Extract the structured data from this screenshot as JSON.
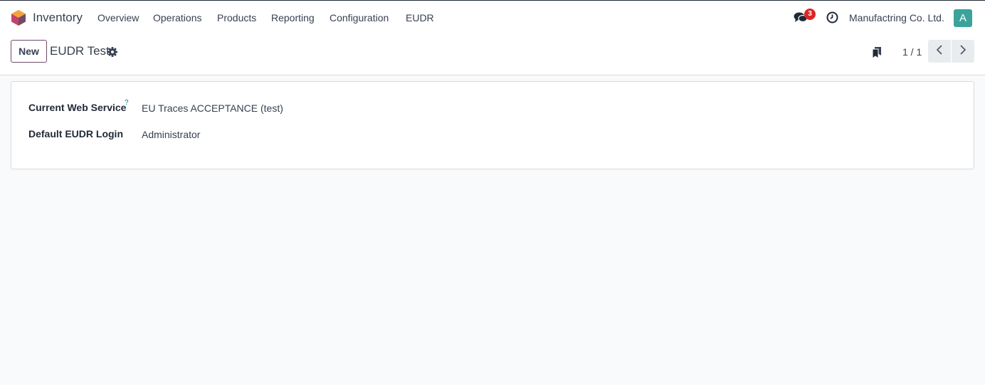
{
  "navbar": {
    "app_name": "Inventory",
    "menu": [
      "Overview",
      "Operations",
      "Products",
      "Reporting",
      "Configuration",
      "EUDR"
    ],
    "messages_count": "3",
    "company": "Manufactring Co. Ltd.",
    "avatar_letter": "A",
    "icons": {
      "logo": "app-logo-icon",
      "chat": "chat-icon",
      "activity": "clock-icon"
    }
  },
  "control_panel": {
    "new_label": "New",
    "record_title": "EUDR Test",
    "pager_value": "1 / 1",
    "icons": {
      "settings": "gear-icon",
      "bookmark": "bookmark-icon",
      "prev": "chevron-left-icon",
      "next": "chevron-right-icon"
    }
  },
  "form": {
    "fields": [
      {
        "label": "Current Web Service",
        "help": "?",
        "value": "EU Traces ACCEPTANCE (test)"
      },
      {
        "label": "Default EUDR Login",
        "value": "Administrator"
      }
    ]
  },
  "colors": {
    "brand": "#714b67",
    "badge": "#dc2626",
    "avatar": "#3aa39b",
    "help": "#017e84"
  }
}
